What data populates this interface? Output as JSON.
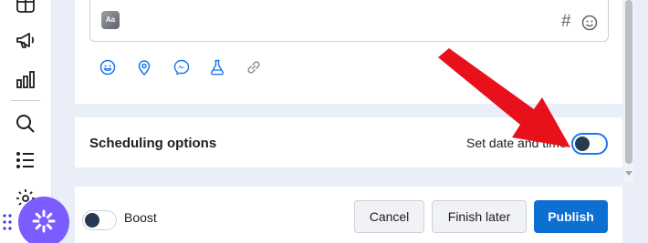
{
  "composer": {
    "format_badge": "Aa",
    "hashtag_symbol": "#"
  },
  "toolbar": {
    "icons": [
      "emoji-icon",
      "location-icon",
      "messenger-icon",
      "flask-icon",
      "link-icon"
    ]
  },
  "scheduling": {
    "title": "Scheduling options",
    "toggle_label": "Set date and time",
    "toggle_on": false
  },
  "footer": {
    "boost_label": "Boost",
    "boost_on": false,
    "cancel_label": "Cancel",
    "finish_later_label": "Finish later",
    "publish_label": "Publish"
  },
  "colors": {
    "publish": "#0c6fd1",
    "fab": "#7a5cff",
    "arrow": "#e8101a",
    "page_bg": "#e9eef8"
  }
}
